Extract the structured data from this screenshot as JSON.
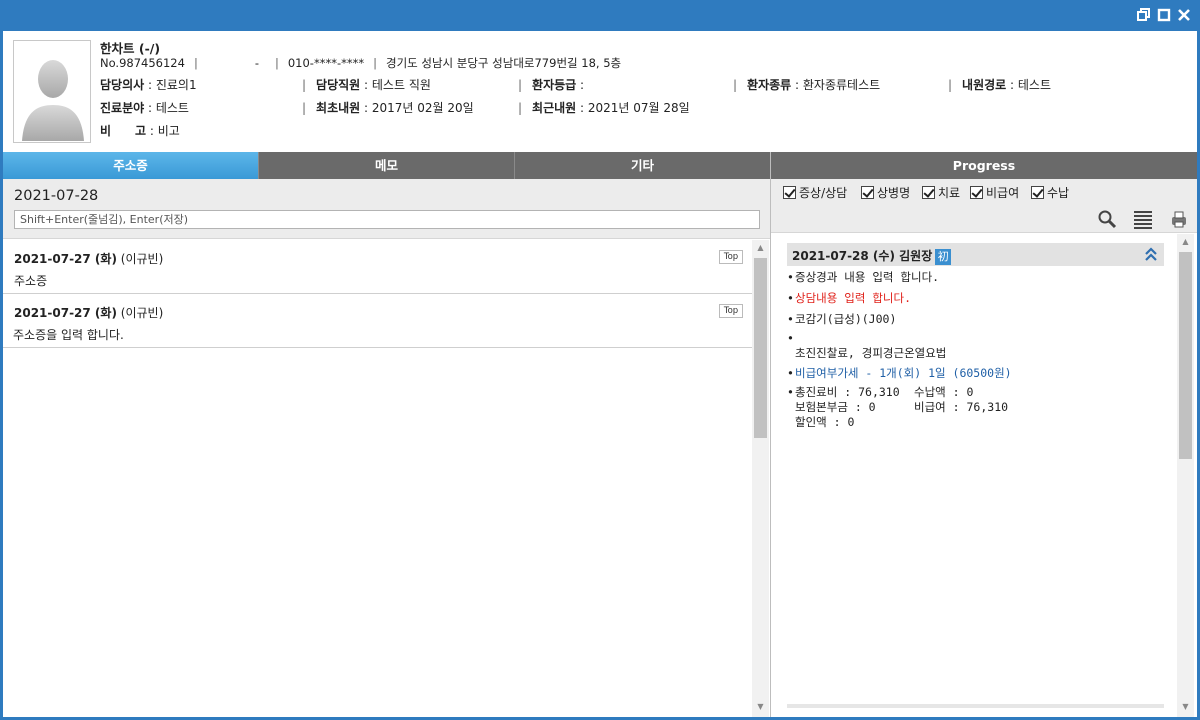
{
  "patient": {
    "name": "한차트 (-/)",
    "number": "No.987456124",
    "id_masked": "-",
    "phone": "010-****-****",
    "address": "경기도 성남시 분당구 성남대로779번길 18, 5층",
    "doctor_label": "담당의사",
    "doctor_value": "진료의1",
    "staff_label": "담당직원",
    "staff_value": "테스트 직원",
    "grade_label": "환자등급",
    "grade_value": "",
    "type_label": "환자종류",
    "type_value": "환자종류테스트",
    "route_label": "내원경로",
    "route_value": "테스트",
    "field_label": "진료분야",
    "field_value": "테스트",
    "first_visit_label": "최초내원",
    "first_visit_value": "2017년 02월 20일",
    "recent_visit_label": "최근내원",
    "recent_visit_value": "2021년 07월 28일",
    "note_label": "비　　고",
    "note_value": "비고"
  },
  "tabs": [
    "주소증",
    "메모",
    "기타"
  ],
  "progress_title": "Progress",
  "left": {
    "date": "2021-07-28",
    "input_placeholder": "Shift+Enter(줄넘김), Enter(저장)",
    "entries": [
      {
        "date": "2021-07-27 (화)",
        "author": "(이규빈)",
        "text": "주소증",
        "top_label": "Top"
      },
      {
        "date": "2021-07-27 (화)",
        "author": "(이규빈)",
        "text": "주소증을 입력 합니다.",
        "top_label": "Top"
      }
    ]
  },
  "right": {
    "filters": [
      "증상/상담",
      "상병명",
      "치료",
      "비급여",
      "수납"
    ],
    "record_header": "2021-07-28 (수) 김원장",
    "first_badge": "初",
    "items": {
      "symptom": "증상경과 내용 입력 합니다.",
      "consult": "상담내용 입력 합니다.",
      "diagnosis": "코감기(급성)(J00)",
      "treatment": "초진진찰료, 경피경근온열요법",
      "noncovered": "비급여부가세 - 1개(회) 1일 (60500원)",
      "total_label": "총진료비 : 76,310",
      "paid_label": "수납액 : 0",
      "insurance_label": "보험본부금 : 0",
      "noncovered_label": "비급여 : 76,310",
      "discount_label": "할인액 : 0"
    }
  },
  "colors": {
    "titlebar": "#2f7bbf",
    "tab_active": "#3a99d6",
    "tab_inactive": "#6a6a6a",
    "red_text": "#e0221b",
    "blue_text": "#1f5fa6"
  }
}
